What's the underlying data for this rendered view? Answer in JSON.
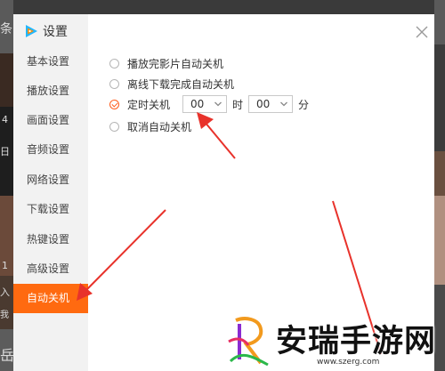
{
  "dialog": {
    "title": "设置"
  },
  "sidebar": {
    "items": [
      {
        "label": "基本设置"
      },
      {
        "label": "播放设置"
      },
      {
        "label": "画面设置"
      },
      {
        "label": "音频设置"
      },
      {
        "label": "网络设置"
      },
      {
        "label": "下载设置"
      },
      {
        "label": "热键设置"
      },
      {
        "label": "高级设置"
      },
      {
        "label": "自动关机",
        "active": true
      }
    ]
  },
  "auto_shutdown": {
    "options": [
      {
        "label": "播放完影片自动关机",
        "checked": false
      },
      {
        "label": "离线下载完成自动关机",
        "checked": false
      },
      {
        "label": "定时关机",
        "checked": true
      },
      {
        "label": "取消自动关机",
        "checked": false
      }
    ],
    "hour_value": "00",
    "hour_unit": "时",
    "minute_value": "00",
    "minute_unit": "分"
  },
  "background": {
    "glyph_1": "条",
    "glyph_2": "4",
    "glyph_3": "日",
    "glyph_4": "1",
    "glyph_5": "入",
    "glyph_6": "我",
    "glyph_7": "岳"
  },
  "watermark": {
    "text": "安瑞手游网",
    "url": "www.szerg.com"
  },
  "colors": {
    "accent": "#ff6a10",
    "arrow": "#e8322b"
  },
  "icons": {
    "logo": "tencent-video-logo-icon",
    "close": "close-icon",
    "caret": "chevron-down-icon"
  }
}
